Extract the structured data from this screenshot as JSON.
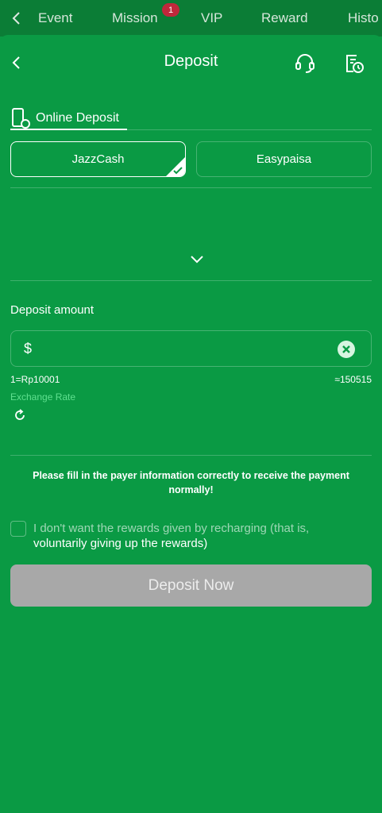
{
  "top_tabs": [
    {
      "label": "Event"
    },
    {
      "label": "Mission",
      "badge": "1"
    },
    {
      "label": "VIP"
    },
    {
      "label": "Reward"
    },
    {
      "label": "Histo"
    }
  ],
  "header": {
    "title": "Deposit",
    "icons": [
      "back-arrow-icon",
      "customer-service-icon",
      "deposit-record-icon"
    ]
  },
  "method_tab": {
    "label": "Online Deposit",
    "icon": "phone-payment-icon"
  },
  "channels": [
    {
      "label": "JazzCash",
      "selected": true
    },
    {
      "label": "Easypaisa",
      "selected": false
    }
  ],
  "amount": {
    "label": "Deposit amount",
    "currency_symbol": "$",
    "value": "",
    "placeholder": ""
  },
  "exchange": {
    "rate_text": "1=Rp10001",
    "converted_text": "≈150515",
    "label": "Exchange Rate"
  },
  "notice": "Please fill in the payer information correctly to receive the payment normally!",
  "rewards_opt_out": {
    "line1": "I don't want the rewards given by recharging (that is,",
    "line2": "voluntarily giving up the rewards)",
    "checked": false
  },
  "submit": {
    "label": "Deposit Now",
    "enabled": false
  },
  "colors": {
    "background": "#0a9a44",
    "topbar": "#0b7d36",
    "badge": "#c0283b",
    "accent_text": "#5fe08f",
    "button_disabled": "#a8a8a8"
  }
}
